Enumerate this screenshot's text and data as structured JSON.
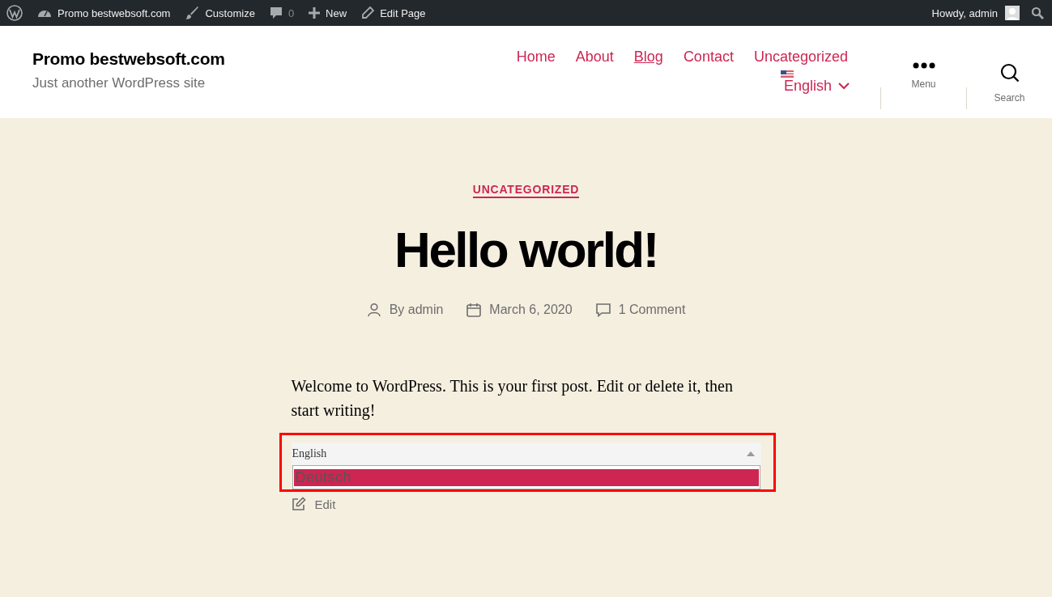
{
  "admin_bar": {
    "items": [
      {
        "kind": "logo"
      },
      {
        "kind": "site",
        "label": "Promo bestwebsoft.com"
      },
      {
        "kind": "customize",
        "label": "Customize"
      },
      {
        "kind": "comments",
        "label": "0"
      },
      {
        "kind": "new",
        "label": "New"
      },
      {
        "kind": "edit",
        "label": "Edit Page"
      }
    ],
    "greeting": "Howdy, admin"
  },
  "header": {
    "site_title": "Promo bestwebsoft.com",
    "tagline": "Just another WordPress site",
    "nav": [
      {
        "label": "Home",
        "selected": false
      },
      {
        "label": "About",
        "selected": false
      },
      {
        "label": "Blog",
        "selected": true
      },
      {
        "label": "Contact",
        "selected": false
      },
      {
        "label": "Uncategorized",
        "selected": false
      }
    ],
    "language": "English",
    "menu_label": "Menu",
    "search_label": "Search"
  },
  "post": {
    "category": "UNCATEGORIZED",
    "title": "Hello world!",
    "author": "By admin",
    "date": "March 6, 2020",
    "comments": "1 Comment",
    "body": "Welcome to WordPress. This is your first post. Edit or delete it, then start writing!",
    "language_select": {
      "value": "English",
      "expanded": true,
      "options": [
        {
          "label": "Deutsch",
          "selected": true
        }
      ]
    },
    "edit_link": "Edit",
    "highlighted": true
  }
}
